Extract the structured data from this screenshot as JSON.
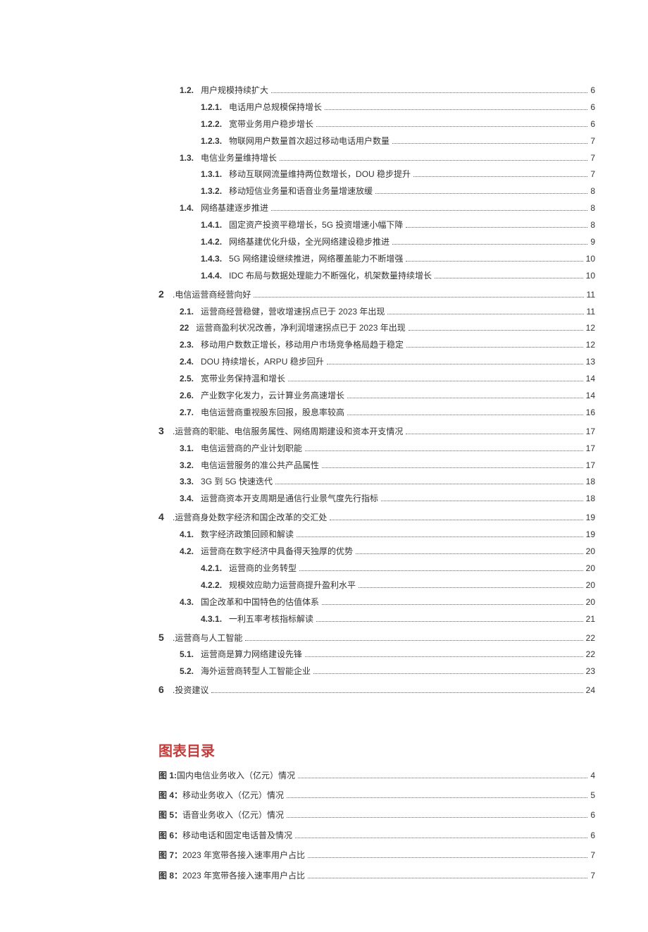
{
  "toc": [
    {
      "indent": 1,
      "num": "1.2.",
      "title": "用户规模持续扩大",
      "page": "6"
    },
    {
      "indent": 2,
      "num": "1.2.1.",
      "title": "电话用户总规模保持增长",
      "page": "6"
    },
    {
      "indent": 2,
      "num": "1.2.2.",
      "title": "宽带业务用户稳步增长",
      "page": "6"
    },
    {
      "indent": 2,
      "num": "1.2.3.",
      "title": "物联网用户数量首次超过移动电话用户数量",
      "page": "7"
    },
    {
      "indent": 1,
      "num": "1.3.",
      "title": "电信业务量维持增长",
      "page": "7"
    },
    {
      "indent": 2,
      "num": "1.3.1.",
      "title": "移动互联网流量维持两位数增长，DOU 稳步提升",
      "page": "7"
    },
    {
      "indent": 2,
      "num": "1.3.2.",
      "title": "移动短信业务量和语音业务量增速放缓",
      "page": "8"
    },
    {
      "indent": 1,
      "num": "1.4.",
      "title": "网络基建逐步推进",
      "page": "8"
    },
    {
      "indent": 2,
      "num": "1.4.1.",
      "title": "固定资产投资平稳增长，5G 投资增速小幅下降",
      "page": "8"
    },
    {
      "indent": 2,
      "num": "1.4.2.",
      "title": "网络基建优化升级，全光网络建设稳步推进",
      "page": "9"
    },
    {
      "indent": 2,
      "num": "1.4.3.",
      "title": "5G 网络建设继续推进，网络覆盖能力不断增强",
      "page": "10"
    },
    {
      "indent": 2,
      "num": "1.4.4.",
      "title": "IDC 布局与数据处理能力不断强化，机架数量持续增长",
      "page": "10"
    },
    {
      "indent": 0,
      "num": "2",
      "title": ".电信运营商经营向好",
      "page": "11",
      "chapter": true
    },
    {
      "indent": 1,
      "num": "2.1.",
      "title": "运营商经营稳健，营收增速拐点已于 2023 年出现",
      "page": "11"
    },
    {
      "indent": 1,
      "num": "22",
      "title": "运营商盈利状况改善，净利润增速拐点已于 2023 年出现",
      "page": "12"
    },
    {
      "indent": 1,
      "num": "2.3.",
      "title": "移动用户数数正增长，移动用户市场竞争格局趋于稳定",
      "page": "12"
    },
    {
      "indent": 1,
      "num": "2.4.",
      "title": "DOU 持续增长，ARPU 稳步回升",
      "page": "13"
    },
    {
      "indent": 1,
      "num": "2.5.",
      "title": "宽带业务保持温和增长",
      "page": "14"
    },
    {
      "indent": 1,
      "num": "2.6.",
      "title": "产业数字化发力，云计算业务高速增长",
      "page": "14"
    },
    {
      "indent": 1,
      "num": "2.7.",
      "title": "电信运营商重视股东回报，股息率较高",
      "page": "16"
    },
    {
      "indent": 0,
      "num": "3",
      "title": ".运营商的职能、电信服务属性、网络周期建设和资本开支情况",
      "page": "17",
      "chapter": true
    },
    {
      "indent": 1,
      "num": "3.1.",
      "title": "电信运营商的产业计划职能",
      "page": "17"
    },
    {
      "indent": 1,
      "num": "3.2.",
      "title": "电信运营服务的准公共产品属性",
      "page": "17"
    },
    {
      "indent": 1,
      "num": "3.3.",
      "title": "3G 到 5G 快速迭代",
      "page": "18"
    },
    {
      "indent": 1,
      "num": "3.4.",
      "title": "运营商资本开支周期是通信行业景气度先行指标",
      "page": "18"
    },
    {
      "indent": 0,
      "num": "4",
      "title": ".运营商身处数字经济和国企改革的交汇处",
      "page": "19",
      "chapter": true
    },
    {
      "indent": 1,
      "num": "4.1.",
      "title": "数字经济政策回顾和解读",
      "page": "19"
    },
    {
      "indent": 1,
      "num": "4.2.",
      "title": "运营商在数字经济中具备得天独厚的优势",
      "page": "20"
    },
    {
      "indent": 2,
      "num": "4.2.1.",
      "title": "运营商的业务转型",
      "page": "20"
    },
    {
      "indent": 2,
      "num": "4.2.2.",
      "title": "规模效应助力运营商提升盈利水平",
      "page": "20"
    },
    {
      "indent": 1,
      "num": "4.3.",
      "title": "国企改革和中国特色的估值体系",
      "page": "20"
    },
    {
      "indent": 2,
      "num": "4.3.1.",
      "title": "一利五率考核指标解读",
      "page": "21"
    },
    {
      "indent": 0,
      "num": "5",
      "title": ".运营商与人工智能",
      "page": "22",
      "chapter": true
    },
    {
      "indent": 1,
      "num": "5.1.",
      "title": "运营商是算力网络建设先锋",
      "page": "22"
    },
    {
      "indent": 1,
      "num": "5.2.",
      "title": "海外运营商转型人工智能企业",
      "page": "23"
    },
    {
      "indent": 0,
      "num": "6",
      "title": ".投资建议",
      "page": "24",
      "chapter": true
    }
  ],
  "figures_heading": "图表目录",
  "figures": [
    {
      "num": "图 1:",
      "title": "国内电信业务收入（亿元）情况",
      "page": "4"
    },
    {
      "num": "图 4：",
      "title": "移动业务收入（亿元）情况",
      "page": "5"
    },
    {
      "num": "图 5：",
      "title": "语音业务收入（亿元）情况",
      "page": "6"
    },
    {
      "num": "图 6：",
      "title": "移动电话和固定电话普及情况",
      "page": "6"
    },
    {
      "num": "图 7：",
      "title": "2023 年宽带各接入速率用户占比",
      "page": "7"
    },
    {
      "num": "图 8：",
      "title": "2023 年宽带各接入速率用户占比",
      "page": "7"
    }
  ]
}
